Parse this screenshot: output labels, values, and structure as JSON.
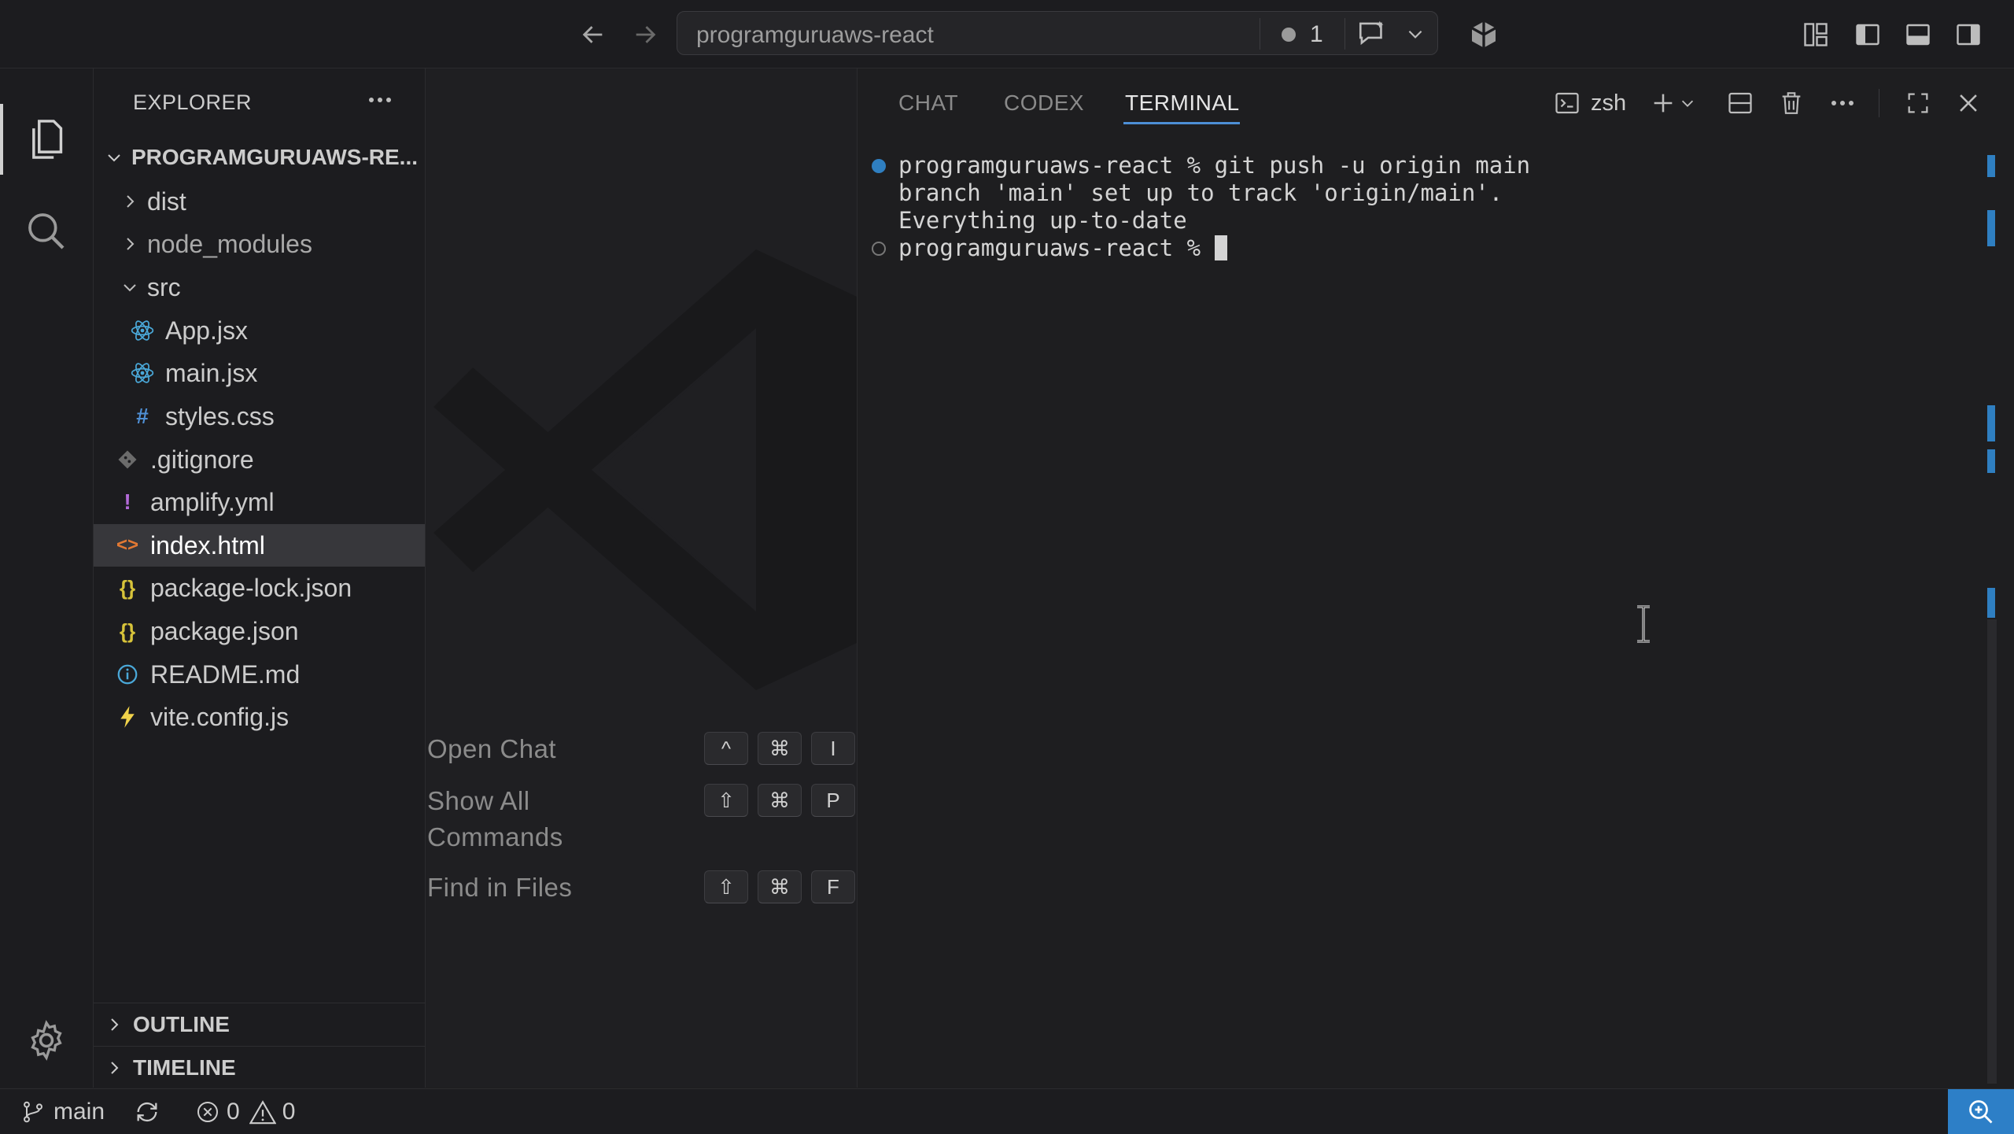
{
  "titlebar": {
    "title": "programguruaws-react",
    "notification_count": "1"
  },
  "explorer": {
    "title": "EXPLORER",
    "root": "PROGRAMGURUAWS-RE...",
    "items": [
      {
        "label": "dist"
      },
      {
        "label": "node_modules"
      },
      {
        "label": "src"
      },
      {
        "label": "App.jsx"
      },
      {
        "label": "main.jsx"
      },
      {
        "label": "styles.css",
        "icon": "#"
      },
      {
        "label": ".gitignore"
      },
      {
        "label": "amplify.yml",
        "icon": "!"
      },
      {
        "label": "index.html",
        "icon": "<>"
      },
      {
        "label": "package-lock.json",
        "icon": "{}"
      },
      {
        "label": "package.json",
        "icon": "{}"
      },
      {
        "label": "README.md"
      },
      {
        "label": "vite.config.js"
      }
    ],
    "outline": "OUTLINE",
    "timeline": "TIMELINE"
  },
  "editor": {
    "shortcuts": [
      {
        "label": "Open Chat",
        "keys": [
          "^",
          "⌘",
          "I"
        ]
      },
      {
        "label": "Show All Commands",
        "keys": [
          "⇧",
          "⌘",
          "P"
        ]
      },
      {
        "label": "Find in Files",
        "keys": [
          "⇧",
          "⌘",
          "F"
        ]
      }
    ]
  },
  "panel": {
    "tabs": [
      "CHAT",
      "CODEX",
      "TERMINAL"
    ],
    "shell": "zsh",
    "terminal_lines": [
      "programguruaws-react % git push -u origin main",
      "branch 'main' set up to track 'origin/main'.",
      "Everything up-to-date",
      "programguruaws-react % "
    ]
  },
  "statusbar": {
    "branch": "main",
    "errors": "0",
    "warnings": "0"
  },
  "colors": {
    "accent": "#2d7fc7",
    "react_icon": "#4aa8d8",
    "css_icon": "#4f8fd4",
    "yaml_icon": "#b36ad8",
    "html_icon": "#e37933",
    "json_icon": "#d7c33a",
    "vite_icon": "#f0d24a"
  }
}
